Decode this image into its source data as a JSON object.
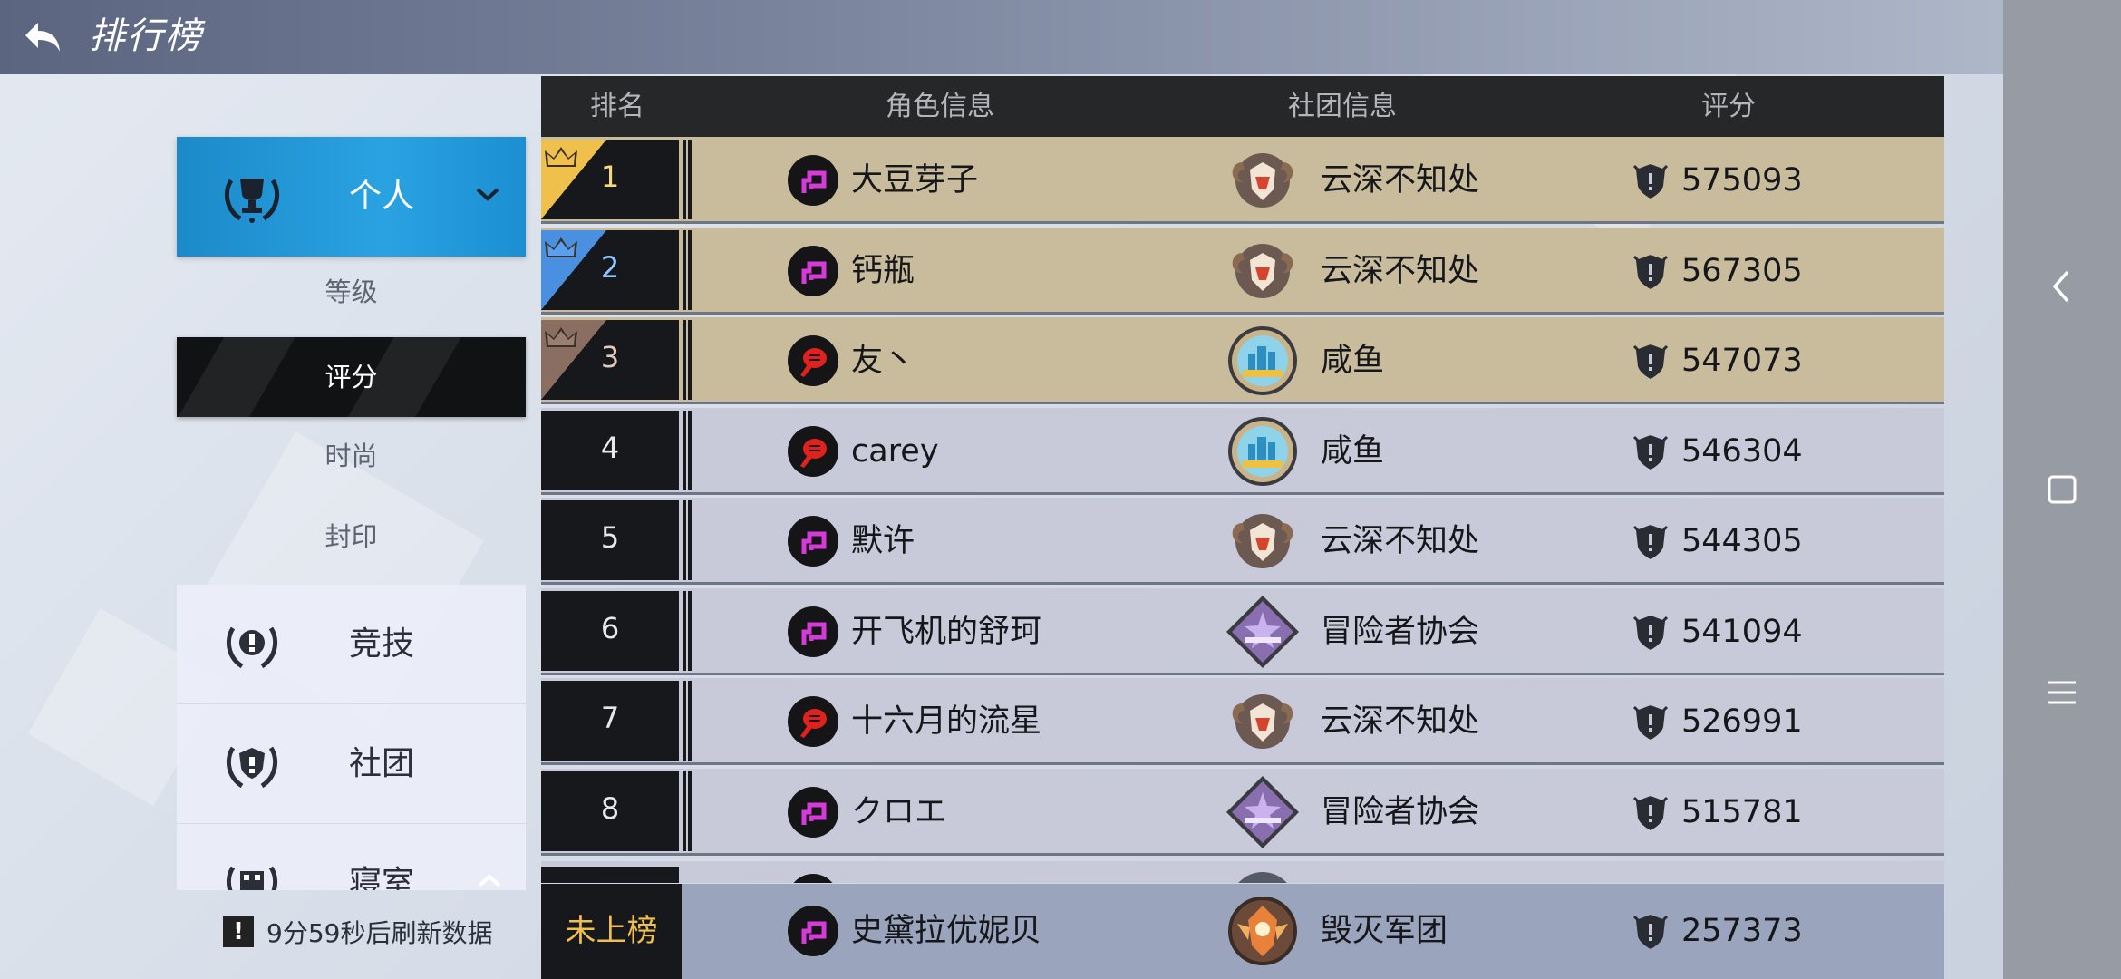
{
  "header": {
    "title": "排行榜",
    "back_icon": "back-arrow-icon",
    "home_icon": "home-icon"
  },
  "sidebar": {
    "personal": {
      "label": "个人",
      "icon": "trophy-laurel-icon",
      "expanded": true
    },
    "sub_items": [
      {
        "label": "等级",
        "active": false
      },
      {
        "label": "评分",
        "active": true
      },
      {
        "label": "时尚",
        "active": false
      },
      {
        "label": "封印",
        "active": false
      }
    ],
    "categories": [
      {
        "label": "竞技",
        "icon": "laurel-exclaim-icon"
      },
      {
        "label": "社团",
        "icon": "shield-laurel-icon"
      },
      {
        "label": "寝室",
        "icon": "dorm-laurel-icon"
      }
    ],
    "refresh_text": "9分59秒后刷新数据"
  },
  "table": {
    "headers": {
      "rank": "排名",
      "role": "角色信息",
      "guild": "社团信息",
      "score": "评分"
    },
    "rows": [
      {
        "rank": "1",
        "name": "大豆芽子",
        "class": "magenta",
        "guild": "云深不知处",
        "emblem": "ram",
        "score": "575093"
      },
      {
        "rank": "2",
        "name": "钙瓶",
        "class": "magenta",
        "guild": "云深不知处",
        "emblem": "ram",
        "score": "567305"
      },
      {
        "rank": "3",
        "name": "友丶",
        "class": "red",
        "guild": "咸鱼",
        "emblem": "city",
        "score": "547073"
      },
      {
        "rank": "4",
        "name": "carey",
        "class": "red",
        "guild": "咸鱼",
        "emblem": "city",
        "score": "546304"
      },
      {
        "rank": "5",
        "name": "默许",
        "class": "magenta",
        "guild": "云深不知处",
        "emblem": "ram",
        "score": "544305"
      },
      {
        "rank": "6",
        "name": "开飞机的舒珂",
        "class": "magenta",
        "guild": "冒险者协会",
        "emblem": "star",
        "score": "541094"
      },
      {
        "rank": "7",
        "name": "十六月的流星",
        "class": "red",
        "guild": "云深不知处",
        "emblem": "ram",
        "score": "526991"
      },
      {
        "rank": "8",
        "name": "クロエ",
        "class": "magenta",
        "guild": "冒险者协会",
        "emblem": "star",
        "score": "515781"
      }
    ],
    "my_row": {
      "rank": "未上榜",
      "name": "史黛拉优妮贝",
      "class": "magenta",
      "guild": "毁灭军团",
      "emblem": "phoenix",
      "score": "257373"
    }
  },
  "colors": {
    "top_row": "#c8bc9c",
    "normal_row": "#c8cad9",
    "gold": "#f0c04c",
    "silver": "#4a8fe0",
    "bronze": "#8a6e62",
    "magenta_class": "#d63ad9",
    "red_class": "#e0221e"
  },
  "system_nav": {
    "back_icon": "nav-back-icon",
    "recents_icon": "nav-square-icon",
    "menu_icon": "nav-menu-icon"
  }
}
